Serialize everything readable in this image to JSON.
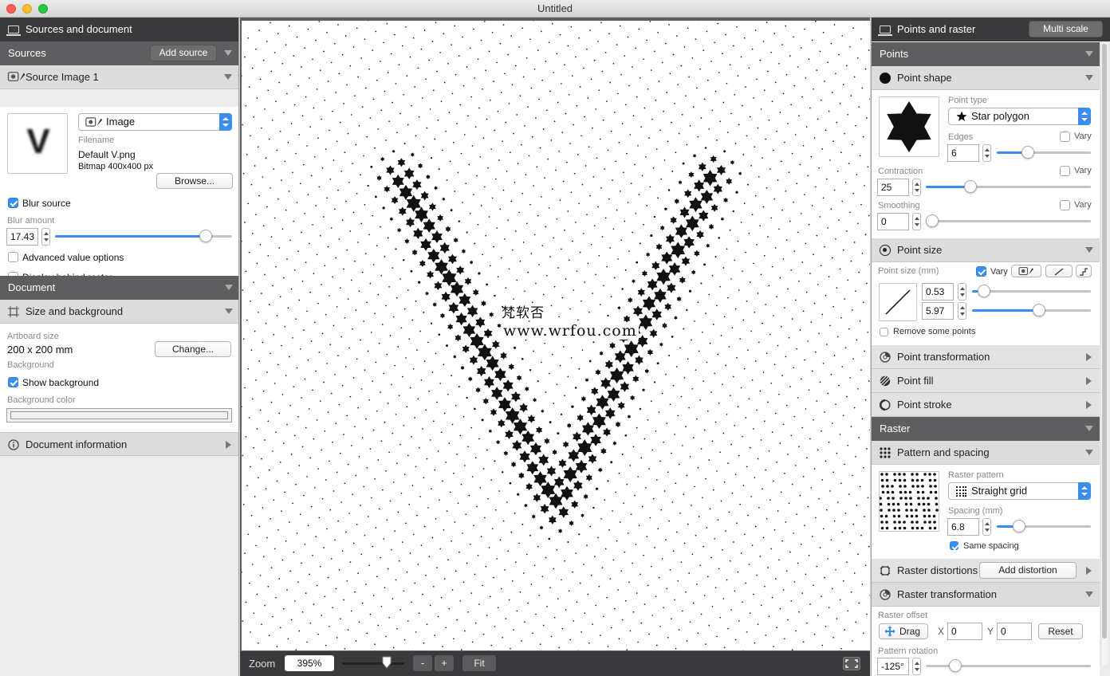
{
  "window": {
    "title": "Untitled"
  },
  "left": {
    "title": "Sources and document",
    "sources": {
      "header": "Sources",
      "add_button": "Add source",
      "source_name": "Source Image 1",
      "type_select": "Image",
      "filename_label": "Filename",
      "filename": "Default V.png",
      "bitmap_info": "Bitmap 400x400 px",
      "browse_button": "Browse...",
      "thumb_letter": "V",
      "blur_source_label": "Blur source",
      "blur_source_checked": true,
      "blur_amount_label": "Blur amount",
      "blur_amount": "17.43",
      "blur_slider": 0.88,
      "advanced_label": "Advanced value options",
      "display_behind_label": "Display behind raster"
    },
    "document": {
      "header": "Document",
      "size_section": "Size and background",
      "artboard_label": "Artboard size",
      "artboard_size": "200 x 200 mm",
      "change_button": "Change...",
      "background_label": "Background",
      "show_background_label": "Show background",
      "show_background_checked": true,
      "background_color_label": "Background color",
      "background_color": "#ffffff",
      "info_section": "Document information"
    }
  },
  "canvas": {
    "zoom_label": "Zoom",
    "zoom_value": "395%",
    "zoom_minus": "-",
    "zoom_plus": "+",
    "fit_button": "Fit",
    "watermark_line1": "梵软否",
    "watermark_line2": "www.wrfou.com"
  },
  "right": {
    "title": "Points and raster",
    "multi_scale_button": "Multi scale",
    "points_header": "Points",
    "point_shape": {
      "section": "Point shape",
      "point_type_label": "Point type",
      "point_type": "Star polygon",
      "edges_label": "Edges",
      "edges": "6",
      "edges_slider": 0.3,
      "vary_label": "Vary",
      "contraction_label": "Contraction",
      "contraction": "25",
      "contraction_slider": 0.25,
      "smoothing_label": "Smoothing",
      "smoothing": "0",
      "smoothing_slider": 0.0
    },
    "point_size": {
      "section": "Point size",
      "label": "Point size (mm)",
      "vary_label": "Vary",
      "min": "0.53",
      "min_slider": 0.05,
      "max": "5.97",
      "max_slider": 0.57,
      "remove_label": "Remove some points"
    },
    "point_transformation": "Point transformation",
    "point_fill": "Point fill",
    "point_stroke": "Point stroke",
    "raster_header": "Raster",
    "pattern": {
      "section": "Pattern and spacing",
      "raster_pattern_label": "Raster pattern",
      "raster_pattern": "Straight grid",
      "spacing_label": "Spacing (mm)",
      "spacing": "6.8",
      "spacing_slider": 0.2,
      "same_spacing_label": "Same spacing"
    },
    "distortions": {
      "section": "Raster distortions",
      "add_button": "Add distortion"
    },
    "transformation": {
      "section": "Raster transformation",
      "offset_label": "Raster offset",
      "drag_button": "Drag",
      "x_label": "X",
      "x_value": "0",
      "y_label": "Y",
      "y_value": "0",
      "reset_button": "Reset",
      "rotation_label": "Pattern rotation",
      "rotation": "-125°",
      "rotation_slider": 0.15
    }
  }
}
